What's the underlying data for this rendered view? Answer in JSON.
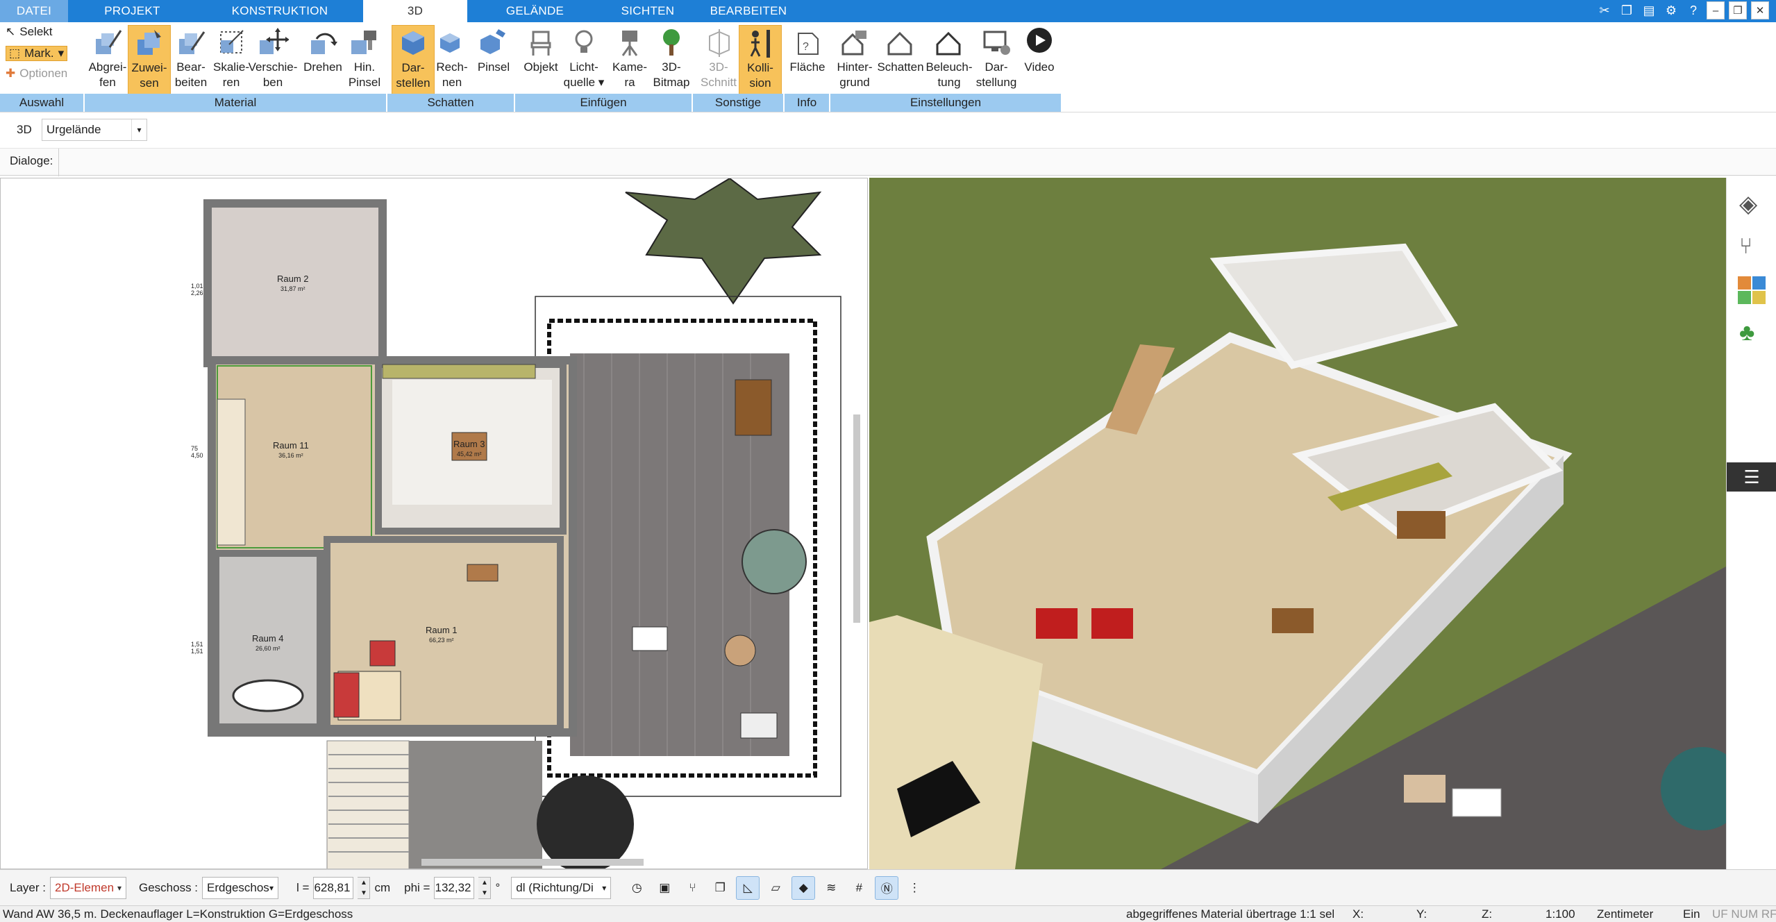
{
  "tabs": [
    {
      "label": "DATEI"
    },
    {
      "label": "PROJEKT"
    },
    {
      "label": "KONSTRUKTION"
    },
    {
      "label": "3D"
    },
    {
      "label": "GELÄNDE"
    },
    {
      "label": "SICHTEN"
    },
    {
      "label": "BEARBEITEN"
    }
  ],
  "selection_tools": {
    "select": "Selekt",
    "mark": "Mark.",
    "options": "Optionen"
  },
  "ribbon_buttons": [
    {
      "line1": "Abgrei-",
      "line2": "fen"
    },
    {
      "line1": "Zuwei-",
      "line2": "sen"
    },
    {
      "line1": "Bear-",
      "line2": "beiten"
    },
    {
      "line1": "Skalie-",
      "line2": "ren"
    },
    {
      "line1": "Verschie-",
      "line2": "ben"
    },
    {
      "line1": "Drehen",
      "line2": ""
    },
    {
      "line1": "Hin.",
      "line2": "Pinsel"
    },
    {
      "line1": "Dar-",
      "line2": "stellen"
    },
    {
      "line1": "Rech-",
      "line2": "nen"
    },
    {
      "line1": "Pinsel",
      "line2": ""
    },
    {
      "line1": "Objekt",
      "line2": ""
    },
    {
      "line1": "Licht-",
      "line2": "quelle"
    },
    {
      "line1": "Kame-",
      "line2": "ra"
    },
    {
      "line1": "3D-",
      "line2": "Bitmap"
    },
    {
      "line1": "3D-",
      "line2": "Schnitt"
    },
    {
      "line1": "Kolli-",
      "line2": "sion"
    },
    {
      "line1": "Fläche",
      "line2": ""
    },
    {
      "line1": "Hinter-",
      "line2": "grund"
    },
    {
      "line1": "Schatten",
      "line2": ""
    },
    {
      "line1": "Beleuch-",
      "line2": "tung"
    },
    {
      "line1": "Dar-",
      "line2": "stellung"
    },
    {
      "line1": "Video",
      "line2": ""
    }
  ],
  "ribbon_groups": [
    {
      "label": "Auswahl"
    },
    {
      "label": "Material"
    },
    {
      "label": "Schatten"
    },
    {
      "label": "Einfügen"
    },
    {
      "label": "Sonstige"
    },
    {
      "label": "Info"
    },
    {
      "label": "Einstellungen"
    }
  ],
  "view_mode": {
    "label": "3D",
    "terrain_value": "Urgelände"
  },
  "dialogs_label": "Dialoge:",
  "rooms": [
    {
      "name": "Raum 2",
      "area": "31,87 m²"
    },
    {
      "name": "Raum 11",
      "area": "36,16 m²"
    },
    {
      "name": "Raum 3",
      "area": "45,42 m²"
    },
    {
      "name": "Raum 4",
      "area": "26,60 m²"
    },
    {
      "name": "Raum 1",
      "area": "66,23 m²"
    }
  ],
  "dimension_labels": [
    "1,01",
    "2,26",
    "75",
    "4,50",
    "1,51",
    "1,51"
  ],
  "bottom": {
    "layer_label": "Layer :",
    "layer_value": "2D-Elemen",
    "floor_label": "Geschoss :",
    "floor_value": "Erdgeschos",
    "length_label": "l =",
    "length_value": "628,81",
    "length_unit": "cm",
    "phi_label": "phi =",
    "phi_value": "132,32",
    "phi_unit": "°",
    "direction_value": "dl (Richtung/Di"
  },
  "status": {
    "left": "Wand AW 36,5 m. Deckenauflager L=Konstruktion G=Erdgeschoss",
    "material": "abgegriffenes Material übertrage 1:1 sel",
    "x": "X:",
    "y": "Y:",
    "z": "Z:",
    "scale": "1:100",
    "unit": "Zentimeter",
    "mode": "Ein",
    "flags": "UF NUM RF"
  },
  "colors": {
    "accent": "#1e7fd6",
    "group_bg": "#9ccaf0",
    "selected": "#f7c25a",
    "grass": "#6d7f3f"
  }
}
